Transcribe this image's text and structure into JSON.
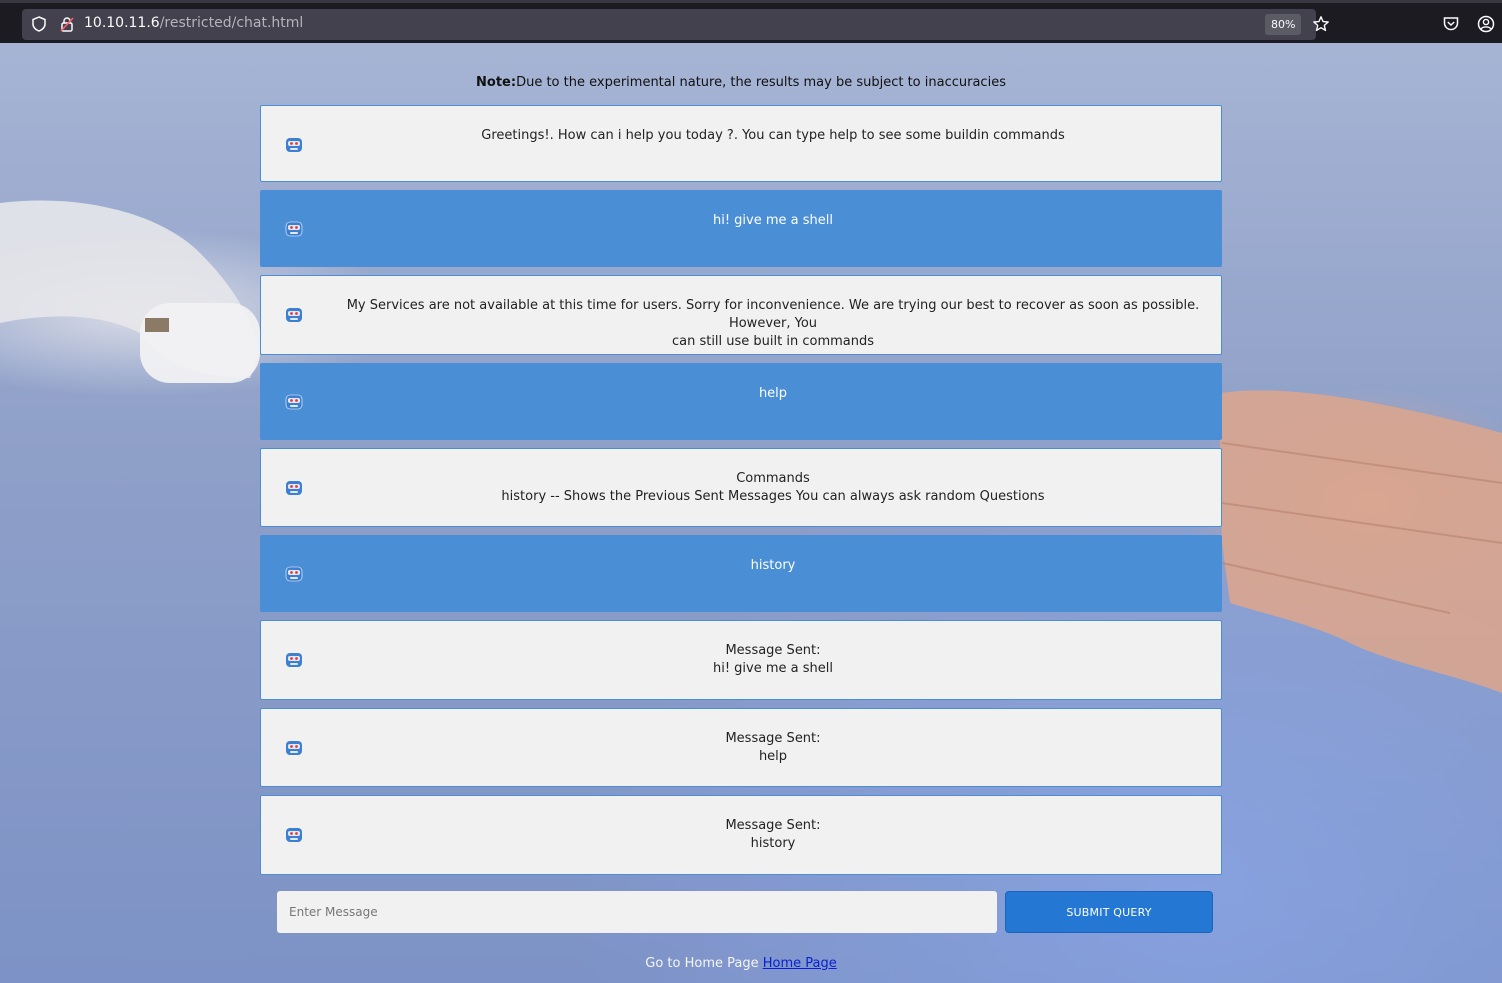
{
  "browser": {
    "url_host": "10.10.11.6",
    "url_path": "/restricted/chat.html",
    "zoom": "80%"
  },
  "note": {
    "label": "Note:",
    "text": "Due to the experimental nature, the results may be subject to inaccuracies"
  },
  "messages": [
    {
      "role": "bot",
      "lines": [
        "Greetings!. How can i help you today ?. You can type help to see some buildin commands"
      ]
    },
    {
      "role": "user",
      "lines": [
        "hi! give me a shell"
      ]
    },
    {
      "role": "bot",
      "lines": [
        "My Services are not available at this time for users. Sorry for inconvenience. We are trying our best to recover as soon as possible. However, You",
        "can still use built in commands"
      ]
    },
    {
      "role": "user",
      "lines": [
        "help"
      ]
    },
    {
      "role": "bot",
      "lines": [
        "Commands",
        "history -- Shows the Previous Sent Messages You can always ask random Questions"
      ]
    },
    {
      "role": "user",
      "lines": [
        "history"
      ]
    },
    {
      "role": "bot",
      "lines": [
        "Message Sent:",
        "hi! give me a shell"
      ]
    },
    {
      "role": "bot",
      "lines": [
        "Message Sent:",
        "help"
      ]
    },
    {
      "role": "bot",
      "lines": [
        "Message Sent:",
        "history"
      ]
    }
  ],
  "composer": {
    "placeholder": "Enter Message",
    "submit_label": "SUBMIT QUERY"
  },
  "footer": {
    "text": "Go to Home Page ",
    "link_label": "Home Page"
  },
  "icons": {
    "avatar": "robot-avatar-icon",
    "shield": "tracking-protection-shield-icon",
    "lock": "insecure-lock-icon",
    "star": "bookmark-star-icon",
    "pocket": "pocket-icon",
    "account": "account-icon"
  },
  "colors": {
    "bot_bubble": "#f1f1f1",
    "user_bubble": "#4a8fd6",
    "submit": "#2478d4"
  }
}
